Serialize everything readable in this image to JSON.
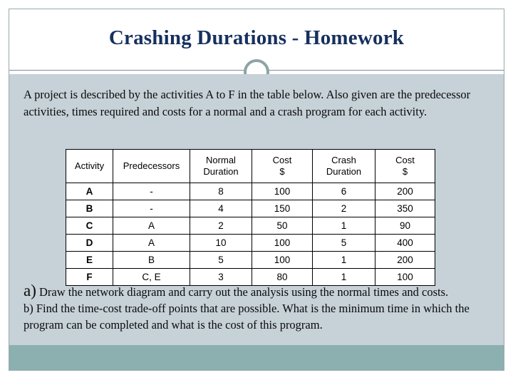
{
  "slide": {
    "title": "Crashing Durations - Homework",
    "title_color": "#16305E",
    "body_background": "#C6D1D8",
    "footer_color": "#8CB0B0",
    "ornament": "ring-ornament"
  },
  "intro": {
    "text": "A project is described by the activities A to F in the table below. Also given are the predecessor activities, times required and costs for a normal and a crash program for each activity."
  },
  "table": {
    "headers": [
      "Activity",
      "Predecessors",
      "Normal Duration",
      "Cost $",
      "Crash Duration",
      "Cost $"
    ],
    "header_lines": [
      [
        "Activity"
      ],
      [
        "Predecessors"
      ],
      [
        "Normal",
        "Duration"
      ],
      [
        "Cost",
        "$"
      ],
      [
        "Crash",
        "Duration"
      ],
      [
        "Cost",
        "$"
      ]
    ],
    "rows": [
      {
        "activity": "A",
        "predecessors": "-",
        "normal_duration": "8",
        "normal_cost": "100",
        "crash_duration": "6",
        "crash_cost": "200"
      },
      {
        "activity": "B",
        "predecessors": "-",
        "normal_duration": "4",
        "normal_cost": "150",
        "crash_duration": "2",
        "crash_cost": "350"
      },
      {
        "activity": "C",
        "predecessors": "A",
        "normal_duration": "2",
        "normal_cost": "50",
        "crash_duration": "1",
        "crash_cost": "90"
      },
      {
        "activity": "D",
        "predecessors": "A",
        "normal_duration": "10",
        "normal_cost": "100",
        "crash_duration": "5",
        "crash_cost": "400"
      },
      {
        "activity": "E",
        "predecessors": "B",
        "normal_duration": "5",
        "normal_cost": "100",
        "crash_duration": "1",
        "crash_cost": "200"
      },
      {
        "activity": "F",
        "predecessors": "C, E",
        "normal_duration": "3",
        "normal_cost": "80",
        "crash_duration": "1",
        "crash_cost": "100"
      }
    ]
  },
  "questions": {
    "a_marker": "a)",
    "a_text": " Draw the network diagram and carry out the analysis using the normal times and costs.",
    "b_text": "b) Find the time-cost trade-off points that are possible. What is the minimum time in which the program can be completed and what is the cost of this program."
  }
}
